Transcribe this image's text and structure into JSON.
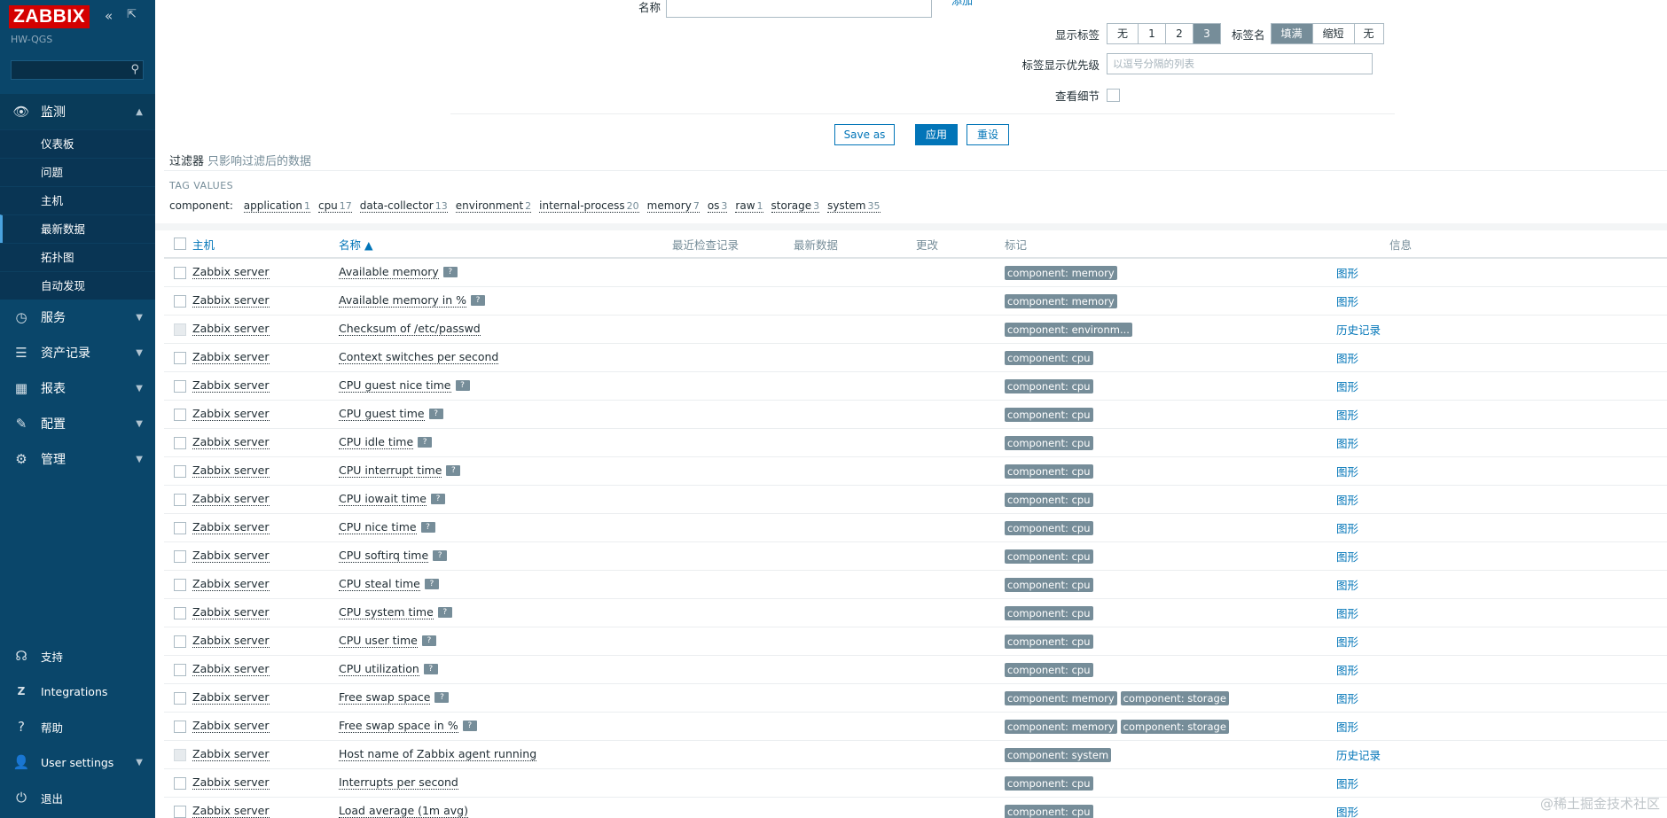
{
  "sidebar": {
    "logo": "ZABBIX",
    "collapse_icon": "«",
    "kiosk_icon": "⇱",
    "server_name": "HW-QGS",
    "nav": [
      {
        "label": "监测",
        "icon": "eye-icon",
        "glyph": "👁"
      },
      {
        "label": "服务",
        "icon": "clock-icon",
        "glyph": "◷"
      },
      {
        "label": "资产记录",
        "icon": "list-icon",
        "glyph": "☰"
      },
      {
        "label": "报表",
        "icon": "bar-chart-icon",
        "glyph": "▦"
      },
      {
        "label": "配置",
        "icon": "wrench-icon",
        "glyph": "✎"
      },
      {
        "label": "管理",
        "icon": "gear-icon",
        "glyph": "⚙"
      }
    ],
    "monitor_sub": [
      "仪表板",
      "问题",
      "主机",
      "最新数据",
      "拓扑图",
      "自动发现"
    ],
    "bottom": [
      {
        "label": "支持",
        "icon": "headset-icon",
        "glyph": "☊"
      },
      {
        "label": "Integrations",
        "icon": "zabbix-z-icon",
        "glyph": "Z"
      },
      {
        "label": "帮助",
        "icon": "question-icon",
        "glyph": "?"
      },
      {
        "label": "User settings",
        "icon": "user-icon",
        "glyph": "👤"
      },
      {
        "label": "退出",
        "icon": "power-icon",
        "glyph": "⏻"
      }
    ]
  },
  "filter": {
    "name_label": "名称",
    "add_link": "添加",
    "show_tags_label": "显示标签",
    "show_tags_options": [
      "无",
      "1",
      "2",
      "3"
    ],
    "tag_name_label": "标签名",
    "tag_name_options": [
      "填满",
      "缩短",
      "无"
    ],
    "tag_priority_label": "标签显示优先级",
    "tag_priority_placeholder": "以逗号分隔的列表",
    "details_label": "查看细节",
    "save_as": "Save as",
    "apply": "应用",
    "reset": "重设",
    "title": "过滤器",
    "hint": "只影响过滤后的数据"
  },
  "tag_values": {
    "header": "TAG VALUES",
    "tag": "component:",
    "values": [
      {
        "name": "application",
        "count": "1"
      },
      {
        "name": "cpu",
        "count": "17"
      },
      {
        "name": "data-collector",
        "count": "13"
      },
      {
        "name": "environment",
        "count": "2"
      },
      {
        "name": "internal-process",
        "count": "20"
      },
      {
        "name": "memory",
        "count": "7"
      },
      {
        "name": "os",
        "count": "3"
      },
      {
        "name": "raw",
        "count": "1"
      },
      {
        "name": "storage",
        "count": "3"
      },
      {
        "name": "system",
        "count": "35"
      }
    ]
  },
  "table": {
    "headers": {
      "host": "主机",
      "name": "名称 ▲",
      "last_check": "最近检查记录",
      "latest": "最新数据",
      "change": "更改",
      "tags": "标记",
      "info": "信息"
    },
    "rows": [
      {
        "host": "Zabbix server",
        "name": "Available memory",
        "help": true,
        "tags": [
          "component: memory"
        ],
        "link": "图形",
        "disabled": false
      },
      {
        "host": "Zabbix server",
        "name": "Available memory in %",
        "help": true,
        "tags": [
          "component: memory"
        ],
        "link": "图形",
        "disabled": false
      },
      {
        "host": "Zabbix server",
        "name": "Checksum of /etc/passwd",
        "help": false,
        "tags": [
          "component: environm..."
        ],
        "link": "历史记录",
        "disabled": true
      },
      {
        "host": "Zabbix server",
        "name": "Context switches per second",
        "help": false,
        "tags": [
          "component: cpu"
        ],
        "link": "图形",
        "disabled": false
      },
      {
        "host": "Zabbix server",
        "name": "CPU guest nice time",
        "help": true,
        "tags": [
          "component: cpu"
        ],
        "link": "图形",
        "disabled": false
      },
      {
        "host": "Zabbix server",
        "name": "CPU guest time",
        "help": true,
        "tags": [
          "component: cpu"
        ],
        "link": "图形",
        "disabled": false
      },
      {
        "host": "Zabbix server",
        "name": "CPU idle time",
        "help": true,
        "tags": [
          "component: cpu"
        ],
        "link": "图形",
        "disabled": false
      },
      {
        "host": "Zabbix server",
        "name": "CPU interrupt time",
        "help": true,
        "tags": [
          "component: cpu"
        ],
        "link": "图形",
        "disabled": false
      },
      {
        "host": "Zabbix server",
        "name": "CPU iowait time",
        "help": true,
        "tags": [
          "component: cpu"
        ],
        "link": "图形",
        "disabled": false
      },
      {
        "host": "Zabbix server",
        "name": "CPU nice time",
        "help": true,
        "tags": [
          "component: cpu"
        ],
        "link": "图形",
        "disabled": false
      },
      {
        "host": "Zabbix server",
        "name": "CPU softirq time",
        "help": true,
        "tags": [
          "component: cpu"
        ],
        "link": "图形",
        "disabled": false
      },
      {
        "host": "Zabbix server",
        "name": "CPU steal time",
        "help": true,
        "tags": [
          "component: cpu"
        ],
        "link": "图形",
        "disabled": false
      },
      {
        "host": "Zabbix server",
        "name": "CPU system time",
        "help": true,
        "tags": [
          "component: cpu"
        ],
        "link": "图形",
        "disabled": false
      },
      {
        "host": "Zabbix server",
        "name": "CPU user time",
        "help": true,
        "tags": [
          "component: cpu"
        ],
        "link": "图形",
        "disabled": false
      },
      {
        "host": "Zabbix server",
        "name": "CPU utilization",
        "help": true,
        "tags": [
          "component: cpu"
        ],
        "link": "图形",
        "disabled": false
      },
      {
        "host": "Zabbix server",
        "name": "Free swap space",
        "help": true,
        "tags": [
          "component: memory",
          "component: storage"
        ],
        "link": "图形",
        "disabled": false
      },
      {
        "host": "Zabbix server",
        "name": "Free swap space in %",
        "help": true,
        "tags": [
          "component: memory",
          "component: storage"
        ],
        "link": "图形",
        "disabled": false
      },
      {
        "host": "Zabbix server",
        "name": "Host name of Zabbix agent running",
        "help": false,
        "tags": [
          "component: system"
        ],
        "link": "历史记录",
        "disabled": true
      },
      {
        "host": "Zabbix server",
        "name": "Interrupts per second",
        "help": false,
        "tags": [
          "component: cpu"
        ],
        "link": "图形",
        "disabled": false
      },
      {
        "host": "Zabbix server",
        "name": "Load average (1m avg)",
        "help": false,
        "tags": [
          "component: cpu"
        ],
        "link": "图形",
        "disabled": false
      }
    ]
  },
  "watermark": "@稀土掘金技术社区"
}
